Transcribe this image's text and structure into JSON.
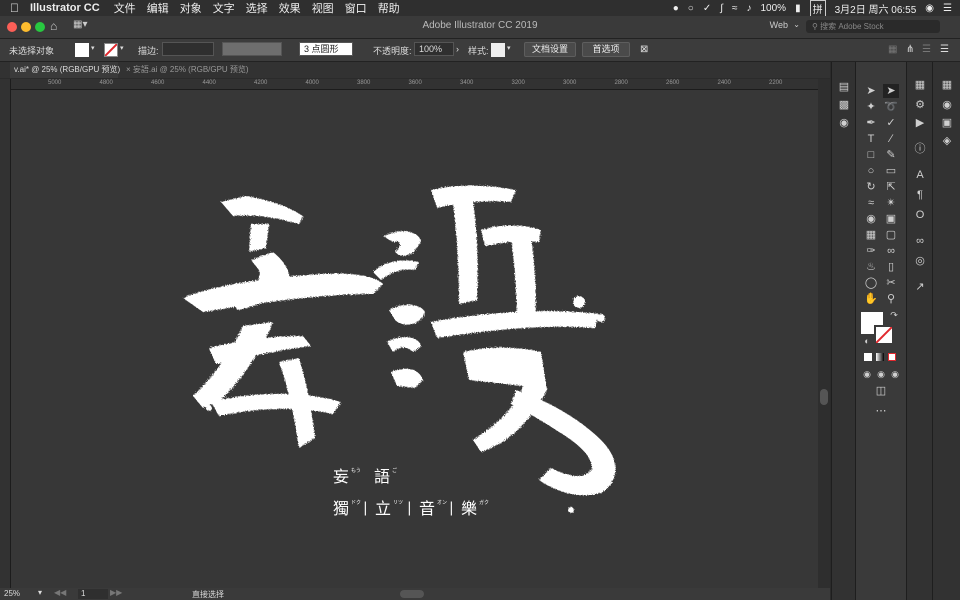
{
  "menubar": {
    "app": "Illustrator CC",
    "items": [
      "文件",
      "编辑",
      "对象",
      "文字",
      "选择",
      "效果",
      "视图",
      "窗口",
      "帮助"
    ],
    "battery": "100%",
    "input_method": "拼",
    "datetime": "3月2日 周六 06:55"
  },
  "window": {
    "title": "Adobe Illustrator CC 2019",
    "workspace": "Web",
    "search_placeholder": "搜索 Adobe Stock"
  },
  "controlbar": {
    "selection": "未选择对象",
    "stroke_label": "描边:",
    "brush": "3 点圆形",
    "opacity_label": "不透明度:",
    "opacity": "100%",
    "style_label": "样式:",
    "doc_setup": "文档设置",
    "prefs": "首选项"
  },
  "tabs": [
    {
      "label": "v.ai* @ 25% (RGB/GPU 预览)",
      "active": true
    },
    {
      "label": "妄語.ai @ 25% (RGB/GPU 预览)",
      "active": false
    }
  ],
  "ruler_ticks": [
    "5000",
    "4800",
    "4600",
    "4400",
    "4200",
    "4000",
    "3800",
    "3600",
    "3400",
    "3200",
    "3000",
    "2800",
    "2600",
    "2400",
    "2200"
  ],
  "artwork": {
    "big1": "妄",
    "big2": "語",
    "line1": [
      "妄",
      "語"
    ],
    "line1_ruby": [
      "もう",
      "ご"
    ],
    "line2": [
      "獨",
      "立",
      "音",
      "樂"
    ],
    "line2_ruby": [
      "ドク",
      "リツ",
      "オン",
      "ガク"
    ],
    "separator": "|"
  },
  "status": {
    "zoom": "25%",
    "artboard": "1",
    "tool": "直接选择"
  }
}
